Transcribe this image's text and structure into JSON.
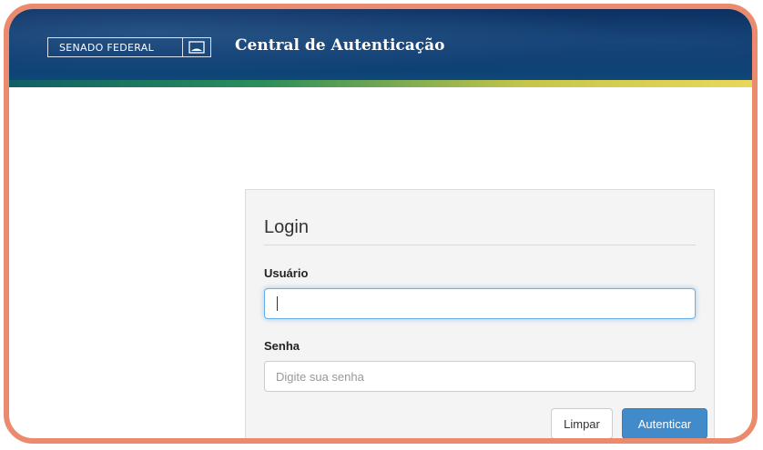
{
  "header": {
    "brand_label": "SENADO FEDERAL",
    "brand_icon": "senate-building-icon",
    "app_title": "Central de Autenticação"
  },
  "login": {
    "title": "Login",
    "username": {
      "label": "Usuário",
      "value": "",
      "placeholder": ""
    },
    "password": {
      "label": "Senha",
      "value": "",
      "placeholder": "Digite sua senha"
    },
    "buttons": {
      "clear_label": "Limpar",
      "submit_label": "Autenticar"
    }
  },
  "colors": {
    "header_bg": "#0c3a6e",
    "frame_border": "#ec8a6e",
    "primary_button": "#428bca",
    "focus_ring": "#66afe9"
  }
}
